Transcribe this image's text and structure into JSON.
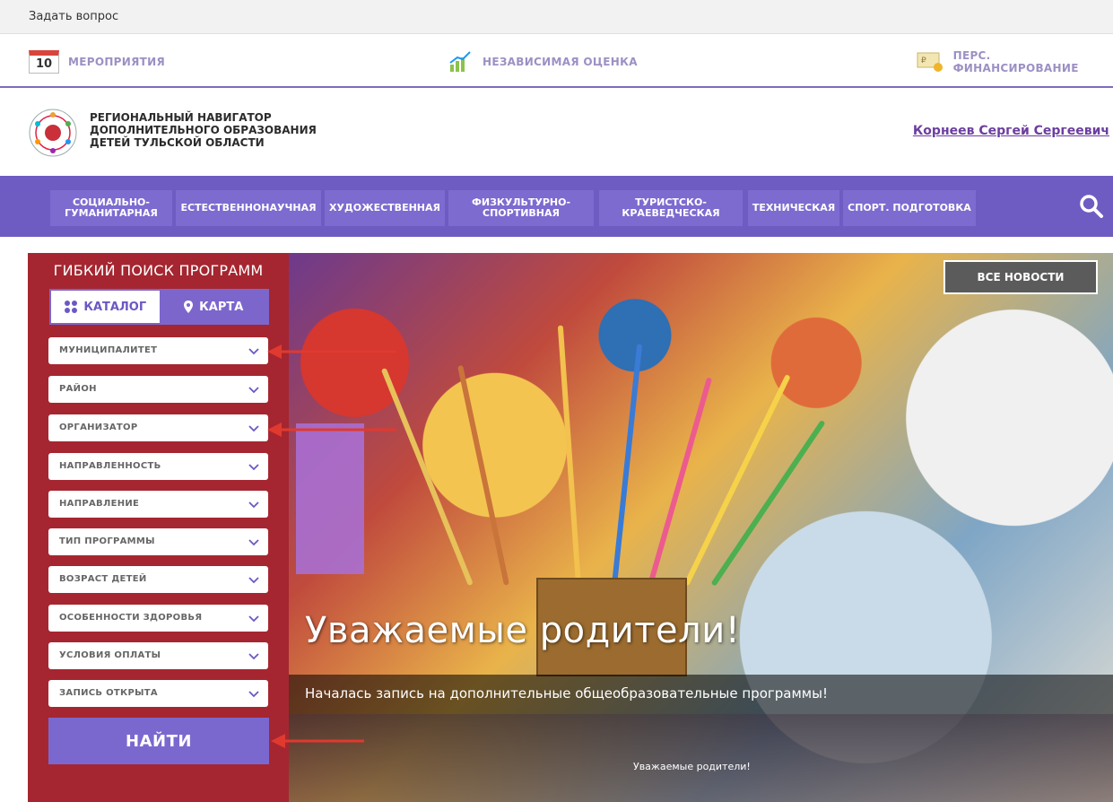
{
  "ask_bar": {
    "label": "Задать вопрос"
  },
  "info_bar": {
    "events": {
      "day": "10",
      "label": "МЕРОПРИЯТИЯ"
    },
    "assessment": {
      "label": "НЕЗАВИСИМАЯ ОЦЕНКА"
    },
    "financing": {
      "label": "ПЕРС. ФИНАНСИРОВАНИЕ"
    }
  },
  "header": {
    "title_line1": "РЕГИОНАЛЬНЫЙ НАВИГАТОР",
    "title_line2": "ДОПОЛНИТЕЛЬНОГО ОБРАЗОВАНИЯ",
    "title_line3": "ДЕТЕЙ ТУЛЬСКОЙ ОБЛАСТИ",
    "user": "Корнеев Сергей Сергеевич"
  },
  "nav": {
    "items": [
      {
        "line1": "СОЦИАЛЬНО-",
        "line2": "ГУМАНИТАРНАЯ"
      },
      {
        "line1": "ЕСТЕСТВЕННОНАУЧНАЯ",
        "line2": ""
      },
      {
        "line1": "ХУДОЖЕСТВЕННАЯ",
        "line2": ""
      },
      {
        "line1": "ФИЗКУЛЬТУРНО-",
        "line2": "СПОРТИВНАЯ"
      },
      {
        "line1": "ТУРИСТСКО-",
        "line2": "КРАЕВЕДЧЕСКАЯ"
      },
      {
        "line1": "ТЕХНИЧЕСКАЯ",
        "line2": ""
      },
      {
        "line1": "СПОРТ. ПОДГОТОВКА",
        "line2": ""
      }
    ]
  },
  "search_panel": {
    "title": "ГИБКИЙ ПОИСК ПРОГРАММ",
    "tab_catalog": "КАТАЛОГ",
    "tab_map": "КАРТА",
    "filters": [
      "МУНИЦИПАЛИТЕТ",
      "РАЙОН",
      "ОРГАНИЗАТОР",
      "НАПРАВЛЕННОСТЬ",
      "НАПРАВЛЕНИЕ",
      "ТИП ПРОГРАММЫ",
      "ВОЗРАСТ ДЕТЕЙ",
      "ОСОБЕННОСТИ ЗДОРОВЬЯ",
      "УСЛОВИЯ ОПЛАТЫ",
      "ЗАПИСЬ ОТКРЫТА"
    ],
    "find_label": "НАЙТИ"
  },
  "banner": {
    "all_news": "ВСЕ НОВОСТИ",
    "title": "Уважаемые родители!",
    "subtitle": "Началась запись на дополнительные общеобразовательные программы!",
    "next_caption": "Уважаемые родители!"
  },
  "colors": {
    "nav_bg": "#6f5cc2",
    "panel_bg": "#a52630",
    "accent": "#7b68cf",
    "annotation_arrow": "#e03a2f"
  }
}
